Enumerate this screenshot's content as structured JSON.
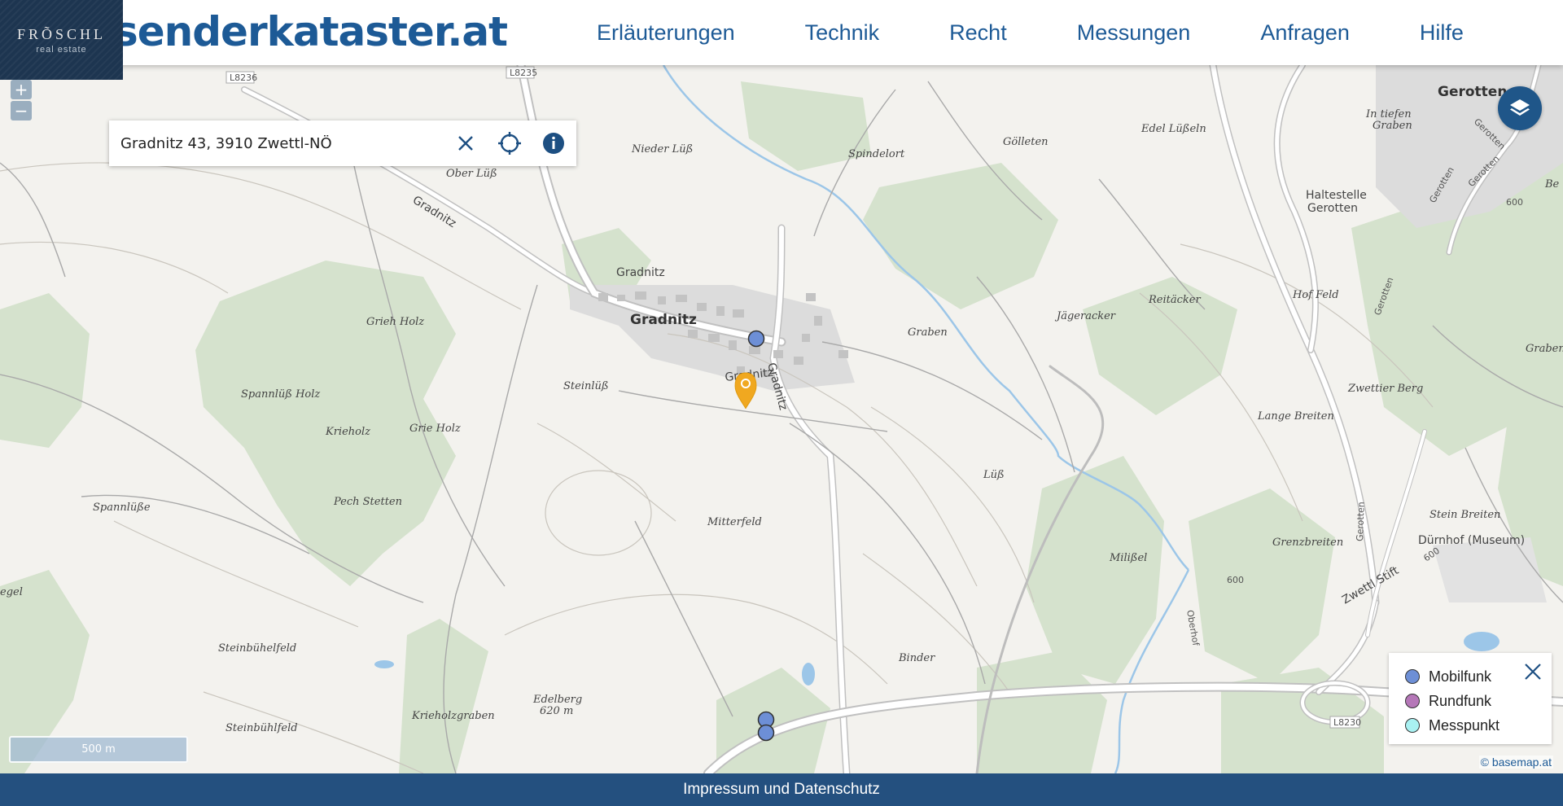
{
  "header": {
    "brand": "senderkataster.at",
    "nav": [
      "Erläuterungen",
      "Technik",
      "Recht",
      "Messungen",
      "Anfragen",
      "Hilfe"
    ]
  },
  "logo": {
    "line1": "FRÕSCHL",
    "line2": "real estate"
  },
  "zoom": {
    "in": "+",
    "out": "−"
  },
  "search": {
    "value": "Gradnitz 43, 3910 Zwettl-NÖ"
  },
  "scale_bar": "500 m",
  "legend": {
    "items": [
      {
        "label": "Mobilfunk",
        "color": "#6d8fd6"
      },
      {
        "label": "Rundfunk",
        "color": "#b577b8"
      },
      {
        "label": "Messpunkt",
        "color": "#a9f1f2"
      }
    ]
  },
  "attribution": "© basemap.at",
  "footer": {
    "link": "Impressum und Datenschutz"
  },
  "map_labels": {
    "gradnitz_main": "Gradnitz",
    "gradnitz_small": "Gradnitz",
    "gradnitz_road": "Gradnitz",
    "gradnitz_road2": "Gradnitz",
    "gradnitz_pin": "Gradnitz",
    "nieder_luess": "Nieder Lüß",
    "ober_luess": "Ober Lüß",
    "spindelort": "Spindelort",
    "goelleten": "Gölleten",
    "edel_luesseln": "Edel Lüßeln",
    "in_tiefen_graben": "In tiefen\nGraben",
    "gerotten": "Gerotten",
    "gerotten_road1": "Gerotten",
    "gerotten_road2": "Gerotten",
    "gerotten_road3": "Gerotten",
    "gerotten_road4": "Gerotten",
    "gerotten_road5": "Gerotten",
    "haltestelle": "Haltestelle\nGerotten",
    "hof_feld": "Hof Feld",
    "reitaecker": "Reitäcker",
    "jaegeracker": "Jägeracker",
    "graben": "Graben",
    "graben_r": "Graben",
    "grieh_holz": "Grieh Holz",
    "spannluess_holz": "Spannlüß Holz",
    "krieholz": "Krieholz",
    "grie_holz": "Grie Holz",
    "steinluess": "Steinlüß",
    "pech_stetten": "Pech Stetten",
    "spannluesse": "Spannlüße",
    "mitterfeld": "Mitterfeld",
    "luess": "Lüß",
    "lange_breiten": "Lange Breiten",
    "zwettier_berg": "Zwettier Berg",
    "stein_breiten": "Stein Breiten",
    "duernhof": "Dürnhof (Museum)",
    "grenzbreiten": "Grenzbreiten",
    "miliessel": "Milißel",
    "zwettl_stift": "Zwettl Stift",
    "oberhof": "Oberhof",
    "binder": "Binder",
    "edelberg": "Edelberg\n620 m",
    "krieholzgraben": "Krieholzgraben",
    "steinbuehelfeld": "Steinbühelfeld",
    "steinbuehlfeld": "Steinbühlfeld",
    "egel": "egel",
    "be": "Be",
    "h600a": "600",
    "h600b": "600",
    "h600c": "600",
    "l8230": "L8230",
    "l8236": "L8236",
    "l8235": "L8235"
  }
}
